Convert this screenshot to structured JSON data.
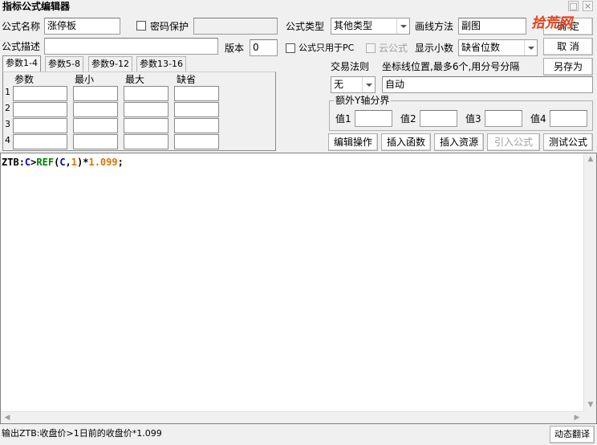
{
  "window": {
    "title": "指标公式编辑器"
  },
  "watermark": {
    "text": "拾荒网"
  },
  "form": {
    "name_label": "公式名称",
    "name_value": "涨停板",
    "password_label": "密码保护",
    "password_value": "",
    "type_label": "公式类型",
    "type_value": "其他类型",
    "draw_label": "画线方法",
    "draw_value": "副图",
    "desc_label": "公式描述",
    "desc_value": "",
    "version_label": "版本",
    "version_value": "0",
    "pc_only_label": "公式只用于PC",
    "cloud_label": "云公式",
    "decimal_label": "显示小数",
    "decimal_value": "缺省位数"
  },
  "buttons": {
    "ok": "确  定",
    "cancel": "取  消",
    "save_as": "另存为",
    "edit_ops": "编辑操作",
    "insert_func": "插入函数",
    "insert_res": "插入资源",
    "import": "引入公式",
    "test": "测试公式",
    "dyn_translate": "动态翻译"
  },
  "tabs": [
    "参数1-4",
    "参数5-8",
    "参数9-12",
    "参数13-16"
  ],
  "params": {
    "headers": [
      "参数",
      "最小",
      "最大",
      "缺省"
    ],
    "rows": [
      "1",
      "2",
      "3",
      "4"
    ]
  },
  "trade": {
    "label": "交易法则",
    "value": "无",
    "coord_label": "坐标线位置,最多6个,用分号分隔",
    "coord_value": "自动"
  },
  "yaxis": {
    "title": "额外Y轴分界",
    "labels": [
      "值1",
      "值2",
      "值3",
      "值4"
    ]
  },
  "code": {
    "tokens": [
      {
        "text": "ZTB",
        "color": "#000000"
      },
      {
        "text": ":",
        "color": "#000000"
      },
      {
        "text": "C",
        "color": "#0000c8"
      },
      {
        "text": ">",
        "color": "#000000"
      },
      {
        "text": "REF",
        "color": "#008000"
      },
      {
        "text": "(",
        "color": "#000000"
      },
      {
        "text": "C",
        "color": "#0000c8"
      },
      {
        "text": ",",
        "color": "#000000"
      },
      {
        "text": "1",
        "color": "#e07000"
      },
      {
        "text": ")*",
        "color": "#000000"
      },
      {
        "text": "1.099",
        "color": "#e07000"
      },
      {
        "text": ";",
        "color": "#000000"
      }
    ]
  },
  "status": {
    "text": "输出ZTB:收盘价>1日前的收盘价*1.099"
  }
}
